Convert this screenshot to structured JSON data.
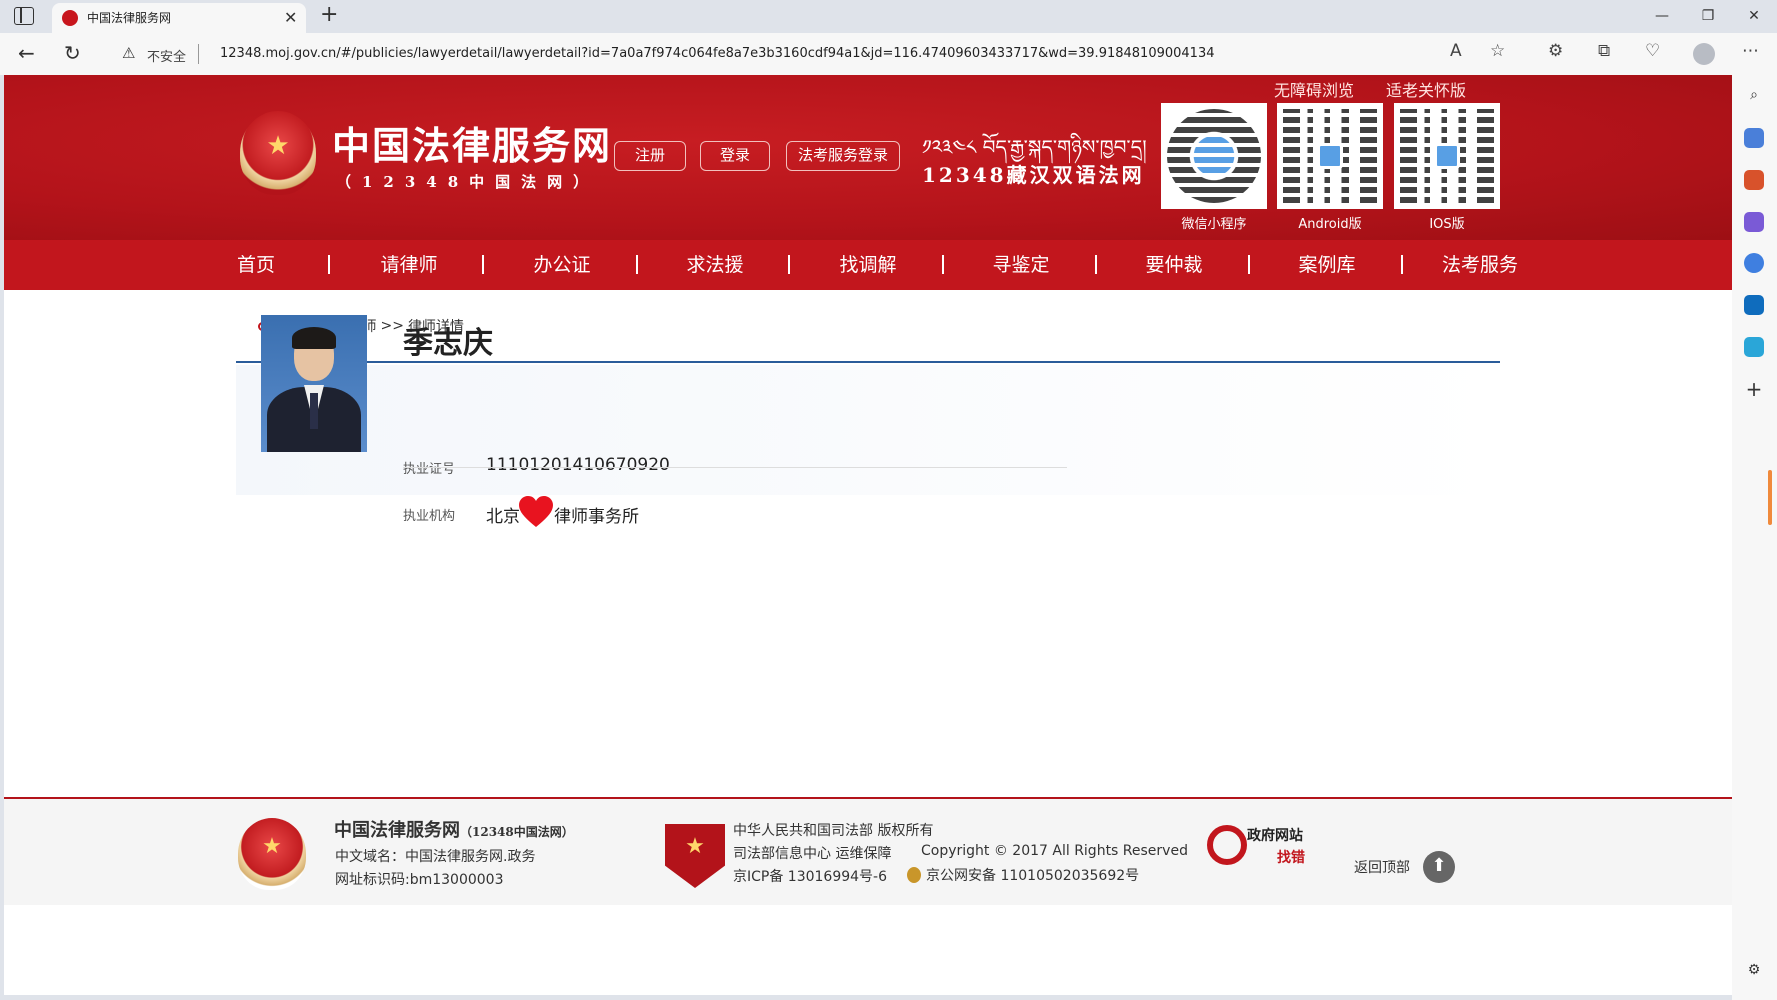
{
  "browser": {
    "tab_title": "中国法律服务网",
    "insecure_label": "不安全",
    "url": "12348.moj.gov.cn/#/publicies/lawyerdetail/lawyerdetail?id=7a0a7f974c064fe8a7e3b3160cdf94a1&jd=116.47409603433717&wd=39.91848109004134"
  },
  "header": {
    "accessibility_link": "无障碍浏览",
    "elder_link": "适老关怀版",
    "site_title": "中国法律服务网",
    "site_subtitle": "（12348中国法网）",
    "register_button": "注册",
    "login_button": "登录",
    "exam_login_button": "法考服务登录",
    "tibetan_text": "༡༢༣༤༨ བོད་རྒྱ་སྐད་གཉིས་ཁྱབ་དྲ།",
    "bilingual_title": "12348藏汉双语法网",
    "qr_codes": [
      {
        "label": "微信小程序"
      },
      {
        "label": "Android版"
      },
      {
        "label": "IOS版"
      }
    ]
  },
  "nav": {
    "items": [
      "首页",
      "请律师",
      "办公证",
      "求法援",
      "找调解",
      "寻鉴定",
      "要仲裁",
      "案例库",
      "法考服务"
    ]
  },
  "breadcrumb": {
    "home": "首页",
    "sep1": ">>",
    "lawyer": "请律师",
    "sep2": ">>",
    "current": "律师详情"
  },
  "lawyer": {
    "name": "季志庆",
    "license_label": "执业证号",
    "license_value": "11101201410670920",
    "firm_label": "执业机构",
    "firm_prefix": "北京",
    "firm_suffix": "律师事务所"
  },
  "footer": {
    "title": "中国法律服务网",
    "title_small": "（12348中国法网）",
    "domain_line": "中文域名：中国法律服务网.政务",
    "site_id_line": "网址标识码:bm13000003",
    "copyright_owner": "中华人民共和国司法部 版权所有",
    "ops_line": "司法部信息中心 运维保障",
    "copyright": "Copyright © 2017 All Rights Reserved",
    "icp": "京ICP备 13016994号-6",
    "police": "京公网安备 11010502035692号",
    "gov_logo_line1": "政府网站",
    "gov_logo_line2": "找错",
    "back_to_top": "返回顶部"
  },
  "colors": {
    "brand_red": "#c2161d",
    "breadcrumb_rule": "#2a5c9a"
  }
}
